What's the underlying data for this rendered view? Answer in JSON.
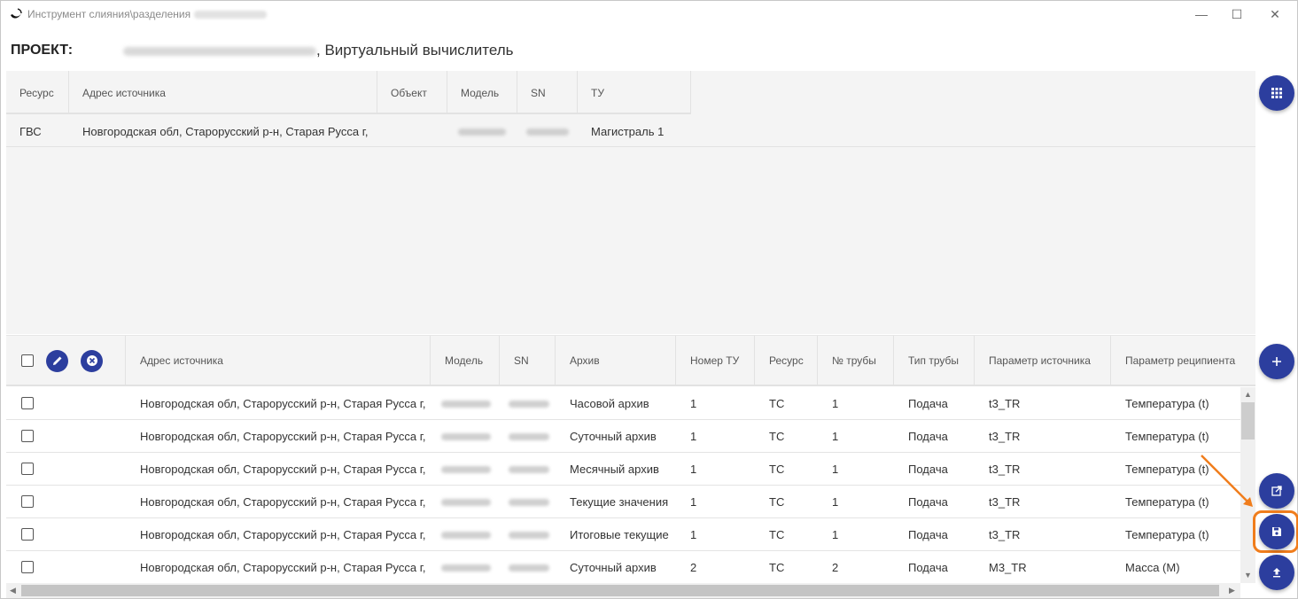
{
  "window": {
    "title": "Инструмент слияния\\разделения",
    "minimize_glyph": "—",
    "maximize_glyph": "☐",
    "close_glyph": "✕"
  },
  "project": {
    "label": "ПРОЕКТ:",
    "name": ", Виртуальный вычислитель"
  },
  "top_table": {
    "columns": [
      "Ресурс",
      "Адрес источника",
      "Объект",
      "Модель",
      "SN",
      "ТУ"
    ],
    "rows": [
      {
        "resource": "ГВС",
        "address": "Новгородская обл, Старорусский р-н, Старая Русса г,",
        "object": "",
        "tu": "Магистраль 1"
      }
    ]
  },
  "bottom_table": {
    "columns": [
      "Адрес источника",
      "Модель",
      "SN",
      "Архив",
      "Номер ТУ",
      "Ресурс",
      "№ трубы",
      "Тип трубы",
      "Параметр источника",
      "Параметр реципиента"
    ],
    "rows": [
      {
        "address": "Новгородская обл, Старорусский р-н, Старая Русса г,",
        "archive": "Часовой архив",
        "tu": "1",
        "resource": "ТС",
        "pipe": "1",
        "pipe_type": "Подача",
        "src_param": "t3_TR",
        "rcp_param": "Температура (t)"
      },
      {
        "address": "Новгородская обл, Старорусский р-н, Старая Русса г,",
        "archive": "Суточный архив",
        "tu": "1",
        "resource": "ТС",
        "pipe": "1",
        "pipe_type": "Подача",
        "src_param": "t3_TR",
        "rcp_param": "Температура (t)"
      },
      {
        "address": "Новгородская обл, Старорусский р-н, Старая Русса г,",
        "archive": "Месячный архив",
        "tu": "1",
        "resource": "ТС",
        "pipe": "1",
        "pipe_type": "Подача",
        "src_param": "t3_TR",
        "rcp_param": "Температура (t)"
      },
      {
        "address": "Новгородская обл, Старорусский р-н, Старая Русса г,",
        "archive": "Текущие значения",
        "tu": "1",
        "resource": "ТС",
        "pipe": "1",
        "pipe_type": "Подача",
        "src_param": "t3_TR",
        "rcp_param": "Температура (t)"
      },
      {
        "address": "Новгородская обл, Старорусский р-н, Старая Русса г,",
        "archive": "Итоговые текущие",
        "tu": "1",
        "resource": "ТС",
        "pipe": "1",
        "pipe_type": "Подача",
        "src_param": "t3_TR",
        "rcp_param": "Температура (t)"
      },
      {
        "address": "Новгородская обл, Старорусский р-н, Старая Русса г,",
        "archive": "Суточный архив",
        "tu": "2",
        "resource": "ТС",
        "pipe": "2",
        "pipe_type": "Подача",
        "src_param": "M3_TR",
        "rcp_param": "Масса (M)"
      }
    ]
  },
  "icons": {
    "grid": "grid-icon",
    "edit": "pencil-icon",
    "remove": "close-circle-icon",
    "add": "plus-icon",
    "open": "open-external-icon",
    "save": "save-icon",
    "upload": "upload-icon"
  },
  "colors": {
    "accent": "#2c3e9e",
    "highlight": "#f07d1c"
  }
}
